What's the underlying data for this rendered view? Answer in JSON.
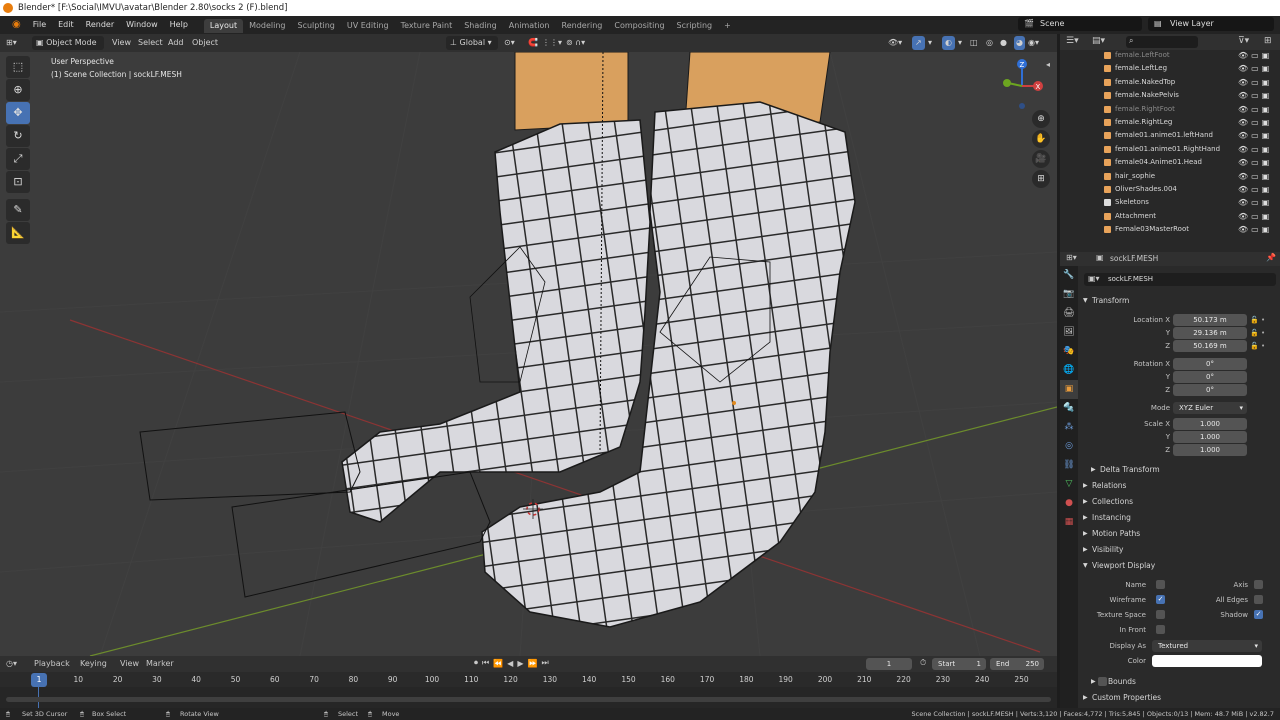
{
  "titlebar": {
    "title": "Blender* [F:\\Social\\IMVU\\avatar\\Blender 2.80\\socks 2 (F).blend]",
    "minimize": "–",
    "maximize": "☐",
    "close": "✕"
  },
  "menu": {
    "items": [
      "File",
      "Edit",
      "Render",
      "Window",
      "Help"
    ]
  },
  "workspaces": [
    "Layout",
    "Modeling",
    "Sculpting",
    "UV Editing",
    "Texture Paint",
    "Shading",
    "Animation",
    "Rendering",
    "Compositing",
    "Scripting"
  ],
  "active_workspace": "Layout",
  "add_workspace": "+",
  "scene": "Scene",
  "view_layer": "View Layer",
  "viewport": {
    "mode": "Object Mode",
    "menus": [
      "View",
      "Select",
      "Add",
      "Object"
    ],
    "transform_orientation": "Global",
    "perspective_label": "User Perspective",
    "collection_label": "(1) Scene Collection | sockLF.MESH",
    "gizmo_axes": [
      "Z",
      "X",
      "Y"
    ]
  },
  "toolbar_tools": [
    "select-box",
    "cursor",
    "move",
    "rotate",
    "scale",
    "transform",
    "annotate",
    "measure"
  ],
  "outliner": {
    "search_placeholder": "",
    "rows": [
      {
        "label": "female.LeftFoot",
        "dim": true
      },
      {
        "label": "female.LeftLeg",
        "dim": false
      },
      {
        "label": "female.NakedTop",
        "dim": false
      },
      {
        "label": "female.NakePelvis",
        "dim": false
      },
      {
        "label": "female.RightFoot",
        "dim": true
      },
      {
        "label": "female.RightLeg",
        "dim": false
      },
      {
        "label": "female01.anime01.leftHand",
        "dim": false
      },
      {
        "label": "female01.anime01.RightHand",
        "dim": false
      },
      {
        "label": "female04.Anime01.Head",
        "dim": false
      },
      {
        "label": "hair_sophie",
        "dim": false
      },
      {
        "label": "OliverShades.004",
        "dim": false
      },
      {
        "label": "Skeletons",
        "dim": false
      },
      {
        "label": "Attachment",
        "dim": false
      },
      {
        "label": "Female03MasterRoot",
        "dim": false
      }
    ]
  },
  "properties": {
    "object_name": "sockLF.MESH",
    "datablock_name": "sockLF.MESH",
    "transform_title": "Transform",
    "location_label": "Location X",
    "location": {
      "x": "50.173 m",
      "y": "29.136 m",
      "z": "50.169 m"
    },
    "rotation_label": "Rotation X",
    "rotation": {
      "x": "0°",
      "y": "0°",
      "z": "0°"
    },
    "mode_label": "Mode",
    "mode": "XYZ Euler",
    "scale_label": "Scale X",
    "scale": {
      "x": "1.000",
      "y": "1.000",
      "z": "1.000"
    },
    "axis_y": "Y",
    "axis_z": "Z",
    "delta_transform": "Delta Transform",
    "panels": [
      "Relations",
      "Collections",
      "Instancing",
      "Motion Paths",
      "Visibility"
    ],
    "viewport_display_title": "Viewport Display",
    "vd": {
      "name_label": "Name",
      "axis_label": "Axis",
      "wireframe_label": "Wireframe",
      "all_edges_label": "All Edges",
      "texture_space_label": "Texture Space",
      "shadow_label": "Shadow",
      "in_front_label": "In Front",
      "display_as_label": "Display As",
      "display_as": "Textured",
      "color_label": "Color"
    },
    "bounds_label": "Bounds",
    "custom_properties": "Custom Properties"
  },
  "timeline": {
    "menus": [
      "Playback",
      "Keying",
      "View",
      "Marker"
    ],
    "current_frame": "1",
    "start_label": "Start",
    "start": "1",
    "end_label": "End",
    "end": "250",
    "ruler_current": "1",
    "ticks": [
      "10",
      "20",
      "30",
      "40",
      "50",
      "60",
      "70",
      "80",
      "90",
      "100",
      "110",
      "120",
      "130",
      "140",
      "150",
      "160",
      "170",
      "180",
      "190",
      "200",
      "210",
      "220",
      "230",
      "240",
      "250"
    ]
  },
  "statusbar": {
    "set_cursor": "Set 3D Cursor",
    "box_select": "Box Select",
    "rotate_view": "Rotate View",
    "select": "Select",
    "move": "Move",
    "stats": "Scene Collection | sockLF.MESH | Verts:3,120 | Faces:4,772 | Tris:5,845 | Objects:0/13 | Mem: 48.7 MiB | v2.82.7"
  },
  "colors": {
    "accent": "#4772b3",
    "viewport_bg": "#3c3c3c",
    "mesh": "#d7d7db",
    "skin": "#d9a05e",
    "x_axis": "#8c3434",
    "y_axis": "#6c8c2c"
  }
}
